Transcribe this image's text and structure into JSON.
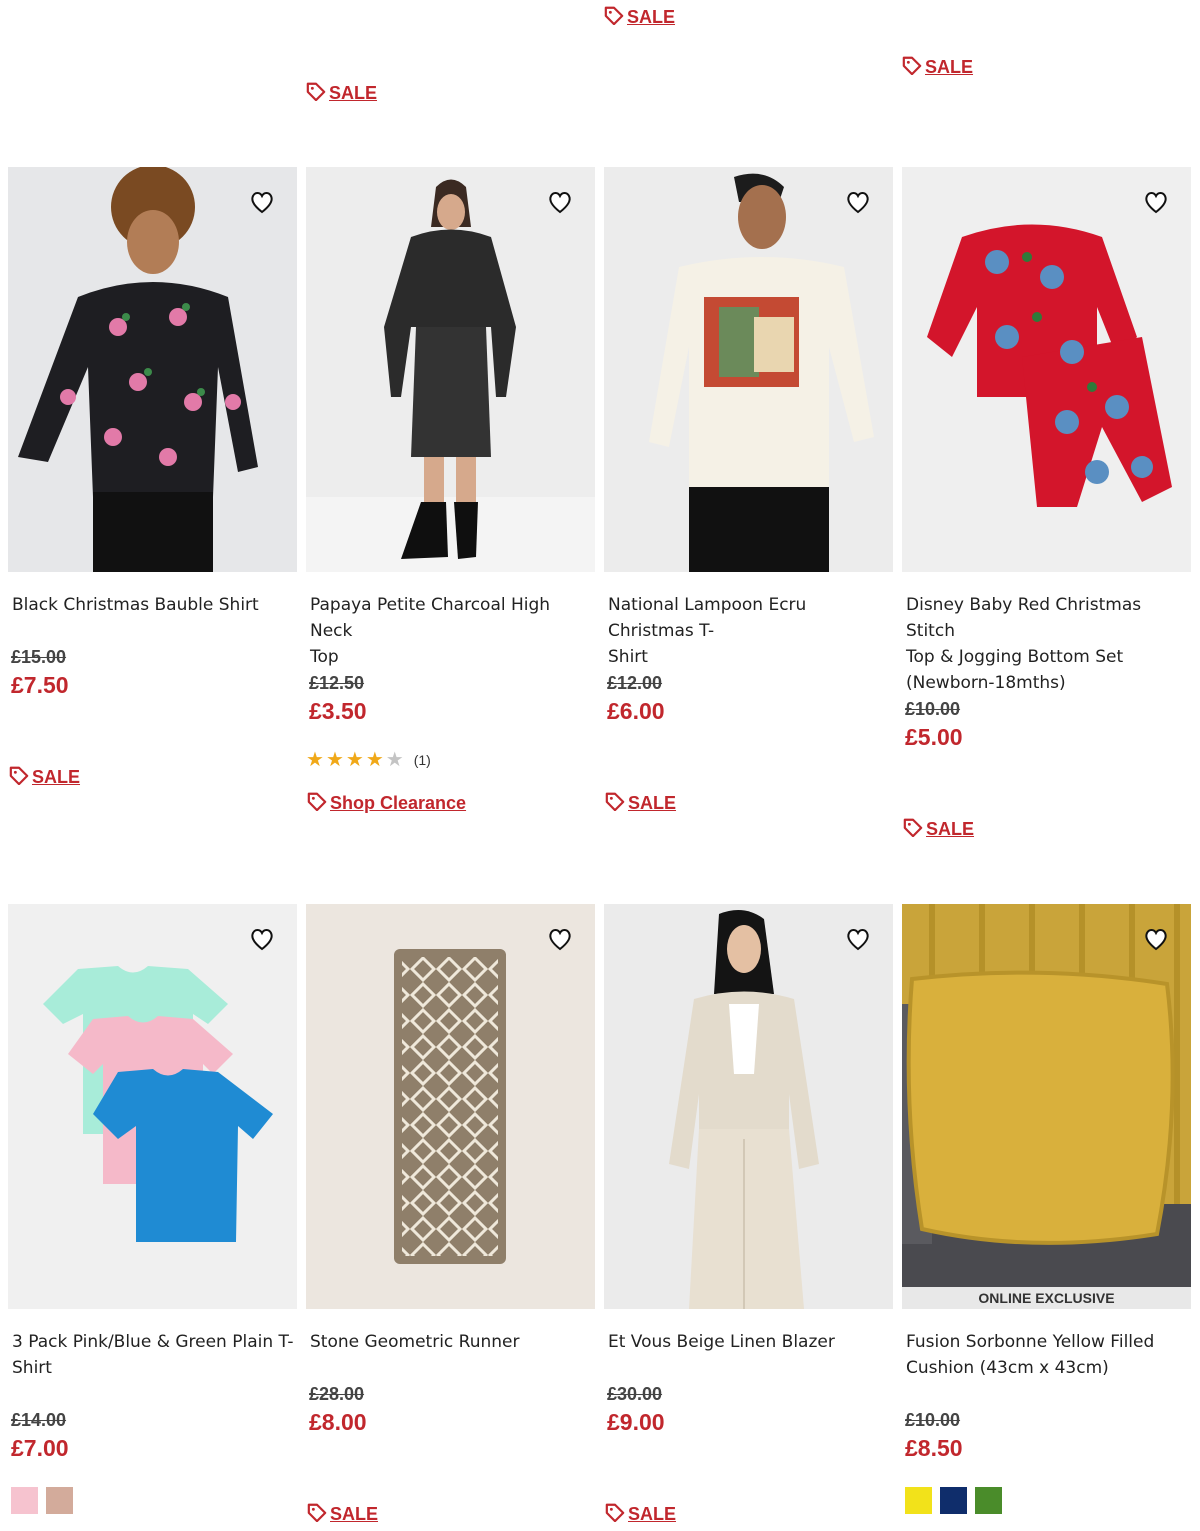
{
  "top_tags": [
    {
      "label": "SALE"
    },
    {
      "label": "SALE"
    },
    {
      "label": "SALE"
    }
  ],
  "products": [
    {
      "title_line1": "Black Christmas Bauble Shirt",
      "title_line2": "",
      "title_line3": "",
      "was": "£15.00",
      "now": "£7.50",
      "tag": "SALE"
    },
    {
      "title_line1": "Papaya Petite Charcoal High Neck",
      "title_line2": "Top",
      "title_line3": "",
      "was": "£12.50",
      "now": "£3.50",
      "rating": 4,
      "rating_count": "(1)",
      "tag": "Shop Clearance"
    },
    {
      "title_line1": "National Lampoon Ecru Christmas T-",
      "title_line2": "Shirt",
      "title_line3": "",
      "was": "£12.00",
      "now": "£6.00",
      "tag": "SALE"
    },
    {
      "title_line1": "Disney Baby Red Christmas Stitch",
      "title_line2": "Top & Jogging Bottom Set",
      "title_line3": "(Newborn-18mths)",
      "was": "£10.00",
      "now": "£5.00",
      "tag": "SALE"
    },
    {
      "title_line1": "3 Pack Pink/Blue & Green Plain T-",
      "title_line2": "Shirt",
      "title_line3": "",
      "was": "£14.00",
      "now": "£7.00",
      "swatches": [
        "#f6c3cf",
        "#d3ab9b"
      ]
    },
    {
      "title_line1": "Stone Geometric Runner",
      "title_line2": "",
      "title_line3": "",
      "was": "£28.00",
      "now": "£8.00",
      "tag": "SALE"
    },
    {
      "title_line1": "Et Vous Beige Linen Blazer",
      "title_line2": "",
      "title_line3": "",
      "was": "£30.00",
      "now": "£9.00",
      "tag": "SALE"
    },
    {
      "title_line1": "Fusion Sorbonne Yellow Filled",
      "title_line2": "Cushion (43cm x 43cm)",
      "title_line3": "",
      "was": "£10.00",
      "now": "£8.50",
      "badge": "ONLINE EXCLUSIVE",
      "swatches": [
        "#f2e21a",
        "#0f2d6b",
        "#4a8c2a"
      ]
    }
  ],
  "colors": {
    "accent": "#c1272d"
  },
  "icons": {
    "wishlist": "heart-icon",
    "tag": "price-tag-icon",
    "star": "star-icon"
  }
}
